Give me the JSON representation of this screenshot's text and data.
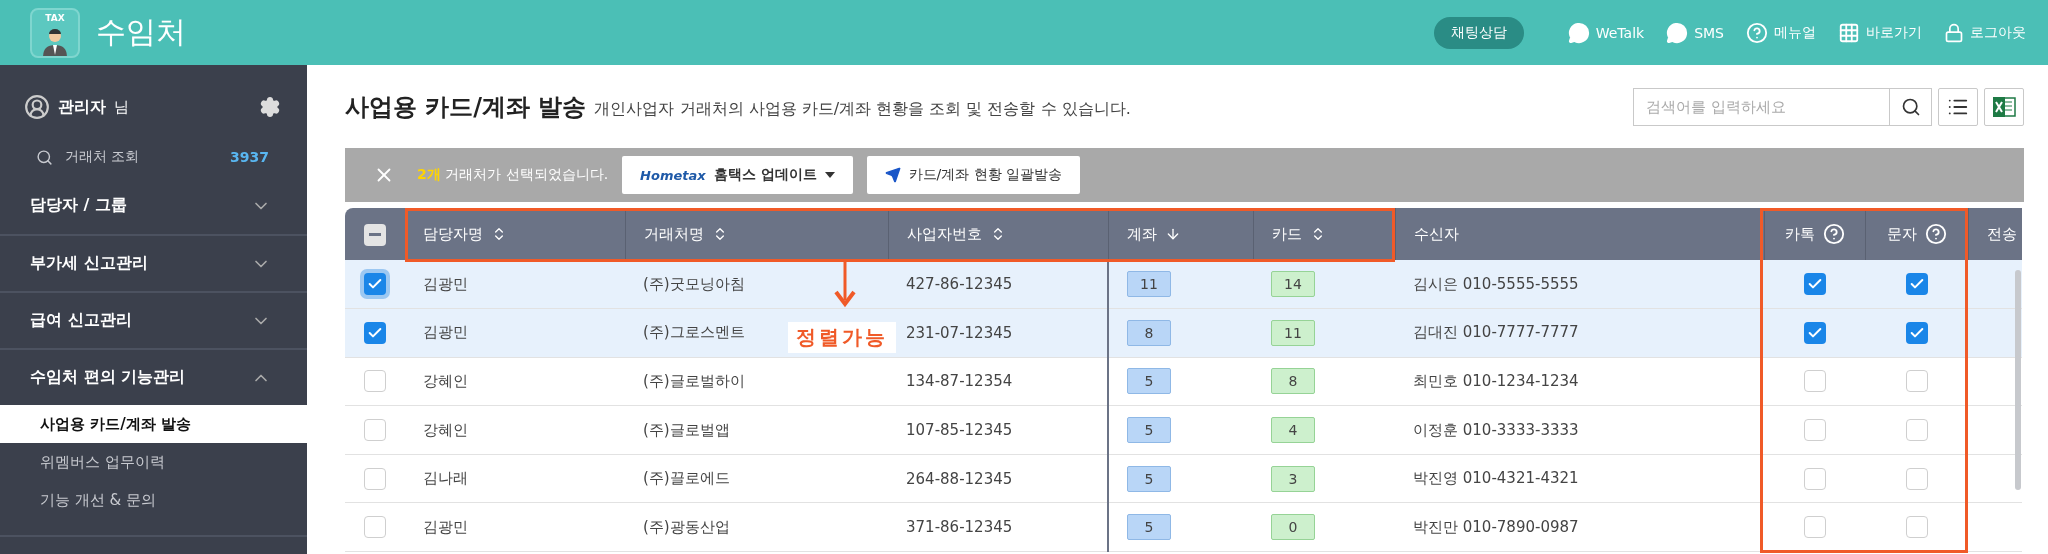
{
  "header": {
    "logo_badge": "TAX",
    "title": "수임처",
    "chat_button": "채팅상담",
    "links": [
      {
        "kind": "chat",
        "label": "WeTalk"
      },
      {
        "kind": "chat",
        "label": "SMS"
      },
      {
        "kind": "help",
        "label": "메뉴얼"
      },
      {
        "kind": "grid",
        "label": "바로가기"
      },
      {
        "kind": "lock",
        "label": "로그아웃"
      }
    ]
  },
  "sidebar": {
    "user": "관리자",
    "user_suffix": "님",
    "search": {
      "label": "거래처 조회",
      "count": "3937"
    },
    "sections": [
      {
        "label": "담당자 / 그룹",
        "expanded": false
      },
      {
        "label": "부가세 신고관리",
        "expanded": false
      },
      {
        "label": "급여 신고관리",
        "expanded": false
      },
      {
        "label": "수임처 편의 기능관리",
        "expanded": true,
        "children": [
          {
            "label": "사업용 카드/계좌 발송",
            "selected": true
          },
          {
            "label": "위멤버스 업무이력",
            "selected": false
          },
          {
            "label": "기능 개선 & 문의",
            "selected": false
          }
        ]
      }
    ]
  },
  "page": {
    "title": "사업용 카드/계좌 발송",
    "subtitle": "개인사업자 거래처의 사업용 카드/계좌 현황을 조회 및 전송할 수 있습니다.",
    "search": {
      "placeholder": "검색어를 입력하세요"
    }
  },
  "selection_bar": {
    "count": "2개",
    "message": "거래처가 선택되었습니다.",
    "hometax_logo": "Hometax",
    "hometax_button": "홈택스 업데이트",
    "send_button": "카드/계좌 현황 일괄발송"
  },
  "table": {
    "select_all_partial": true,
    "columns": [
      {
        "label": "담당자명",
        "sortable": true,
        "sorted_desc": false,
        "help": false
      },
      {
        "label": "거래처명",
        "sortable": true,
        "sorted_desc": false,
        "help": false
      },
      {
        "label": "사업자번호",
        "sortable": true,
        "sorted_desc": false,
        "help": false
      },
      {
        "label": "계좌",
        "sortable": true,
        "sorted_desc": true,
        "help": false
      },
      {
        "label": "카드",
        "sortable": true,
        "sorted_desc": false,
        "help": false
      },
      {
        "label": "수신자",
        "sortable": false,
        "help": false
      },
      {
        "label": "카톡",
        "sortable": false,
        "help": true
      },
      {
        "label": "문자",
        "sortable": false,
        "help": true
      },
      {
        "label": "전송",
        "sortable": false,
        "help": false
      }
    ],
    "rows": [
      {
        "selected": true,
        "focused": true,
        "manager": "김광민",
        "client": "(주)굿모닝아침",
        "biz_no": "427-86-12345",
        "account": "11",
        "card": "14",
        "recipient": "김시은 010-5555-5555",
        "kakao": true,
        "sms": true
      },
      {
        "selected": true,
        "focused": false,
        "manager": "김광민",
        "client": "(주)그로스멘트",
        "biz_no": "231-07-12345",
        "account": "8",
        "card": "11",
        "recipient": "김대진 010-7777-7777",
        "kakao": true,
        "sms": true
      },
      {
        "selected": false,
        "focused": false,
        "manager": "강혜인",
        "client": "(주)글로벌하이",
        "biz_no": "134-87-12354",
        "account": "5",
        "card": "8",
        "recipient": "최민호 010-1234-1234",
        "kakao": false,
        "sms": false
      },
      {
        "selected": false,
        "focused": false,
        "manager": "강혜인",
        "client": "(주)글로벌앱",
        "biz_no": "107-85-12345",
        "account": "5",
        "card": "4",
        "recipient": "이정훈 010-3333-3333",
        "kakao": false,
        "sms": false
      },
      {
        "selected": false,
        "focused": false,
        "manager": "김나래",
        "client": "(주)끌로에드",
        "biz_no": "264-88-12345",
        "account": "5",
        "card": "3",
        "recipient": "박진영 010-4321-4321",
        "kakao": false,
        "sms": false
      },
      {
        "selected": false,
        "focused": false,
        "manager": "김광민",
        "client": "(주)광동산업",
        "biz_no": "371-86-12345",
        "account": "5",
        "card": "0",
        "recipient": "박진만 010-7890-0987",
        "kakao": false,
        "sms": false
      }
    ]
  },
  "annotation": {
    "text": "정렬가능"
  }
}
